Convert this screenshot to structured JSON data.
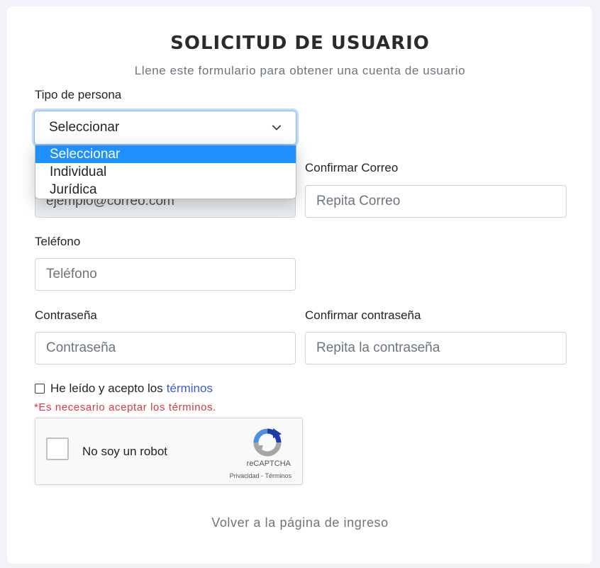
{
  "header": {
    "title": "SOLICITUD DE USUARIO",
    "subtitle": "Llene este formulario para obtener una cuenta de usuario"
  },
  "tipo_persona": {
    "label": "Tipo de persona",
    "selected": "Seleccionar",
    "options": [
      "Seleccionar",
      "Individual",
      "Jurídica"
    ]
  },
  "correo": {
    "value": "ejemplo@correo.com"
  },
  "confirmar_correo": {
    "label": "Confirmar Correo",
    "placeholder": "Repita Correo"
  },
  "telefono": {
    "label": "Teléfono",
    "placeholder": "Teléfono"
  },
  "contrasena": {
    "label": "Contraseña",
    "placeholder": "Contraseña"
  },
  "confirmar_contrasena": {
    "label": "Confirmar contraseña",
    "placeholder": "Repita la contraseña"
  },
  "terminos": {
    "text": "He leído y acepto los",
    "link": "términos",
    "error": "*Es necesario aceptar los términos."
  },
  "captcha": {
    "label": "No soy un robot",
    "brand": "reCAPTCHA",
    "links": "Privacidad - Términos"
  },
  "footer": {
    "back_link": "Volver a la página de ingreso"
  },
  "colors": {
    "accent": "#1e90ff",
    "link": "#3d5bd9",
    "error": "#dc3545"
  }
}
